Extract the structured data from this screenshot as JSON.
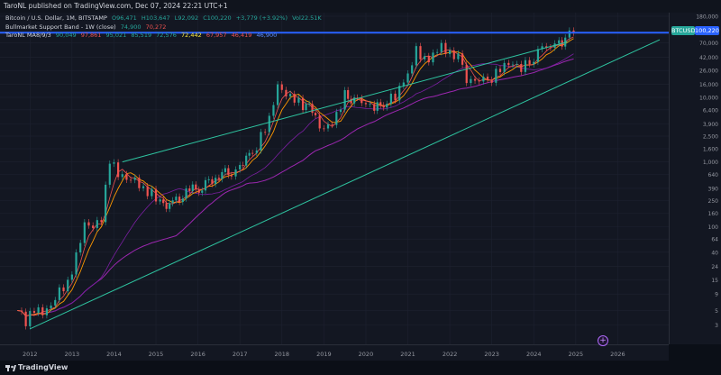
{
  "header": {
    "publish_text": "TaroNL published on TradingView.com, Dec 07, 2024 22:21 UTC+1"
  },
  "legend": {
    "symbol": "Bitcoin / U.S. Dollar, 1M, BITSTAMP",
    "open": "O96,471",
    "high": "H103,647",
    "low": "L92,092",
    "close": "C100,220",
    "change": "+3,779 (+3.92%)",
    "vol": "Vol22.51K",
    "band_title": "Bullmarket Support Band - 1W (close)",
    "band_v1": "74,900",
    "band_v2": "70,272",
    "ma_title": "TaroNL MA8/9/3",
    "ma_values": [
      "90,049",
      "97,861",
      "95,021",
      "85,519",
      "72,576",
      "72,442",
      "67,957",
      "46,419",
      "46,900"
    ]
  },
  "price_tags": {
    "symbol": "BTCUSD",
    "last": "100,220"
  },
  "footer": {
    "brand": "TradingView"
  },
  "colors": {
    "up": "#26a69a",
    "down": "#ef5350",
    "trend": "#2ec4a0",
    "hline": "#2962ff",
    "ma_purple": "#9c27b0",
    "ma_orange": "#ff9800"
  },
  "chart_data": {
    "type": "candlestick",
    "symbol": "BTCUSD",
    "interval": "1M",
    "y_scale": "log",
    "yticks": [
      3,
      5,
      9,
      15,
      24,
      40,
      64,
      100,
      160,
      250,
      390,
      640,
      1000,
      1600,
      2500,
      3900,
      6400,
      10000,
      16000,
      26000,
      42000,
      70000,
      180000
    ],
    "ylim": [
      2,
      180000
    ],
    "xticks": [
      "2012",
      "2013",
      "2014",
      "2015",
      "2016",
      "2017",
      "2018",
      "2019",
      "2020",
      "2021",
      "2022",
      "2023",
      "2024",
      "2025",
      "2026"
    ],
    "xlim": [
      2011.5,
      2027.0
    ],
    "price_line": 100220,
    "trendlines": [
      {
        "x": [
          2014.2,
          2024.8
        ],
        "y": [
          1000,
          72000
        ]
      },
      {
        "x": [
          2012.0,
          2027.0
        ],
        "y": [
          2.6,
          78000
        ]
      }
    ],
    "monthly_close": [
      {
        "x": 2011.7,
        "y": 5.0
      },
      {
        "x": 2011.9,
        "y": 3.2
      },
      {
        "x": 2012.1,
        "y": 5.5
      },
      {
        "x": 2012.3,
        "y": 5.0
      },
      {
        "x": 2012.5,
        "y": 6.5
      },
      {
        "x": 2012.7,
        "y": 11
      },
      {
        "x": 2012.9,
        "y": 13
      },
      {
        "x": 2013.1,
        "y": 33
      },
      {
        "x": 2013.3,
        "y": 100
      },
      {
        "x": 2013.5,
        "y": 90
      },
      {
        "x": 2013.7,
        "y": 125
      },
      {
        "x": 2013.9,
        "y": 1100
      },
      {
        "x": 2014.1,
        "y": 700
      },
      {
        "x": 2014.3,
        "y": 600
      },
      {
        "x": 2014.5,
        "y": 580
      },
      {
        "x": 2014.7,
        "y": 380
      },
      {
        "x": 2014.9,
        "y": 320
      },
      {
        "x": 2015.1,
        "y": 220
      },
      {
        "x": 2015.4,
        "y": 230
      },
      {
        "x": 2015.8,
        "y": 360
      },
      {
        "x": 2016.1,
        "y": 410
      },
      {
        "x": 2016.5,
        "y": 650
      },
      {
        "x": 2016.8,
        "y": 700
      },
      {
        "x": 2017.0,
        "y": 960
      },
      {
        "x": 2017.3,
        "y": 1300
      },
      {
        "x": 2017.5,
        "y": 2500
      },
      {
        "x": 2017.7,
        "y": 4300
      },
      {
        "x": 2017.9,
        "y": 13800
      },
      {
        "x": 2018.1,
        "y": 10000
      },
      {
        "x": 2018.3,
        "y": 9000
      },
      {
        "x": 2018.5,
        "y": 7500
      },
      {
        "x": 2018.8,
        "y": 6300
      },
      {
        "x": 2018.9,
        "y": 3700
      },
      {
        "x": 2019.1,
        "y": 3800
      },
      {
        "x": 2019.3,
        "y": 5300
      },
      {
        "x": 2019.5,
        "y": 10800
      },
      {
        "x": 2019.8,
        "y": 8300
      },
      {
        "x": 2020.0,
        "y": 7200
      },
      {
        "x": 2020.2,
        "y": 6400
      },
      {
        "x": 2020.5,
        "y": 9100
      },
      {
        "x": 2020.7,
        "y": 10800
      },
      {
        "x": 2020.9,
        "y": 19700
      },
      {
        "x": 2021.1,
        "y": 33000
      },
      {
        "x": 2021.2,
        "y": 58000
      },
      {
        "x": 2021.4,
        "y": 37000
      },
      {
        "x": 2021.6,
        "y": 41000
      },
      {
        "x": 2021.8,
        "y": 61000
      },
      {
        "x": 2021.9,
        "y": 46000
      },
      {
        "x": 2022.1,
        "y": 43000
      },
      {
        "x": 2022.3,
        "y": 38000
      },
      {
        "x": 2022.4,
        "y": 19800
      },
      {
        "x": 2022.6,
        "y": 20000
      },
      {
        "x": 2022.8,
        "y": 20500
      },
      {
        "x": 2022.9,
        "y": 16500
      },
      {
        "x": 2023.1,
        "y": 23000
      },
      {
        "x": 2023.3,
        "y": 29000
      },
      {
        "x": 2023.5,
        "y": 30000
      },
      {
        "x": 2023.7,
        "y": 26000
      },
      {
        "x": 2023.9,
        "y": 37700
      },
      {
        "x": 2024.0,
        "y": 42500
      },
      {
        "x": 2024.2,
        "y": 71000
      },
      {
        "x": 2024.4,
        "y": 60600
      },
      {
        "x": 2024.5,
        "y": 62700
      },
      {
        "x": 2024.6,
        "y": 64600
      },
      {
        "x": 2024.75,
        "y": 70300
      },
      {
        "x": 2024.85,
        "y": 96400
      },
      {
        "x": 2024.95,
        "y": 100220
      }
    ]
  }
}
